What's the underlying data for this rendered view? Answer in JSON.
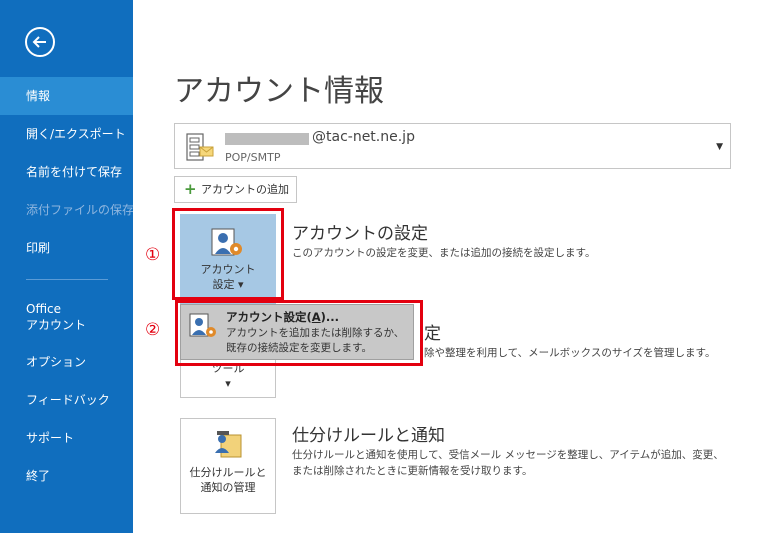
{
  "sidebar": {
    "items": [
      {
        "label": "情報"
      },
      {
        "label": "開く/エクスポート"
      },
      {
        "label": "名前を付けて保存"
      },
      {
        "label": "添付ファイルの保存"
      },
      {
        "label": "印刷"
      },
      {
        "label": "Office\nアカウント"
      },
      {
        "label": "オプション"
      },
      {
        "label": "フィードバック"
      },
      {
        "label": "サポート"
      },
      {
        "label": "終了"
      }
    ]
  },
  "main": {
    "title": "アカウント情報",
    "account": {
      "email": "@tac-net.ne.jp",
      "type": "POP/SMTP"
    },
    "add_account_label": "アカウントの追加",
    "account_settings": {
      "button_label": "アカウント\n設定 ▾",
      "title": "アカウントの設定",
      "desc": "このアカウントの設定を変更、または追加の接続を設定します。"
    },
    "mailbox": {
      "title_fragment": "定",
      "desc_fragment": "除や整理を利用して、メールボックスのサイズを管理します。",
      "button_label": "ツール\n▾"
    },
    "rules": {
      "button_label": "仕分けルールと\n通知の管理",
      "title": "仕分けルールと通知",
      "desc": "仕分けルールと通知を使用して、受信メール メッセージを整理し、アイテムが追加、変更、または削除されたときに更新情報を受け取ります。"
    },
    "dropdown": {
      "title_prefix": "アカウント設定(",
      "title_key": "A",
      "title_suffix": ")...",
      "desc": "アカウントを追加または削除するか、\n既存の接続設定を変更します。"
    }
  },
  "annotations": {
    "step1": "①",
    "step2": "②"
  },
  "colors": {
    "sidebar_bg": "#106ebe",
    "sidebar_active": "#2a8dd4",
    "highlight": "#e3000f"
  }
}
